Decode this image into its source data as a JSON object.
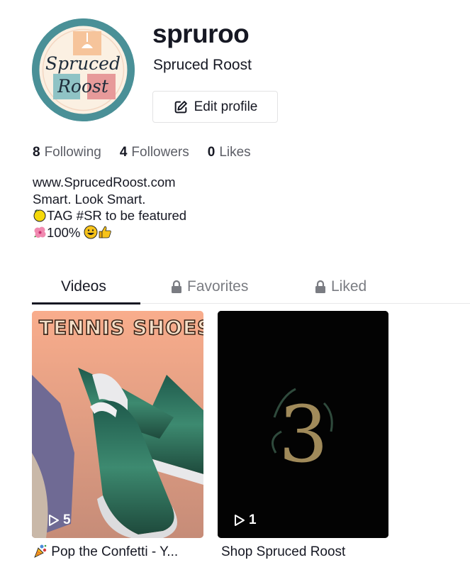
{
  "profile": {
    "username": "spruroo",
    "nickname": "Spruced Roost",
    "avatar_text_line1": "Spruced",
    "avatar_text_line2": "Roost",
    "edit_button_label": "Edit profile"
  },
  "stats": [
    {
      "count": "8",
      "label": "Following"
    },
    {
      "count": "4",
      "label": "Followers"
    },
    {
      "count": "0",
      "label": "Likes"
    }
  ],
  "bio": {
    "line1": "www.SprucedRoost.com",
    "line2": "Smart. Look Smart.",
    "line3_emoji": "lemon-emoji",
    "line3": "TAG #SR to be featured",
    "line4_emoji": "hibiscus-emoji",
    "line4": "100% ",
    "line4_trailing_emojis": [
      "grinning-face-emoji",
      "thumbs-up-emoji"
    ]
  },
  "tabs": [
    {
      "label": "Videos",
      "active": true,
      "locked": false
    },
    {
      "label": "Favorites",
      "active": false,
      "locked": true
    },
    {
      "label": "Liked",
      "active": false,
      "locked": true
    }
  ],
  "videos": [
    {
      "thumbnail_text": "TENNIS SHOES",
      "play_count": "5",
      "caption_emoji": "party-popper-emoji",
      "caption": "Pop the Confetti - Y..."
    },
    {
      "thumbnail_text": "3",
      "play_count": "1",
      "caption": "Shop Spruced Roost"
    }
  ],
  "colors": {
    "text_primary": "#161823",
    "text_secondary": "#5c5e66",
    "tab_inactive": "#7a7c82",
    "avatar_ring": "#4a9097",
    "card1_bg": "#f8ae8d"
  }
}
